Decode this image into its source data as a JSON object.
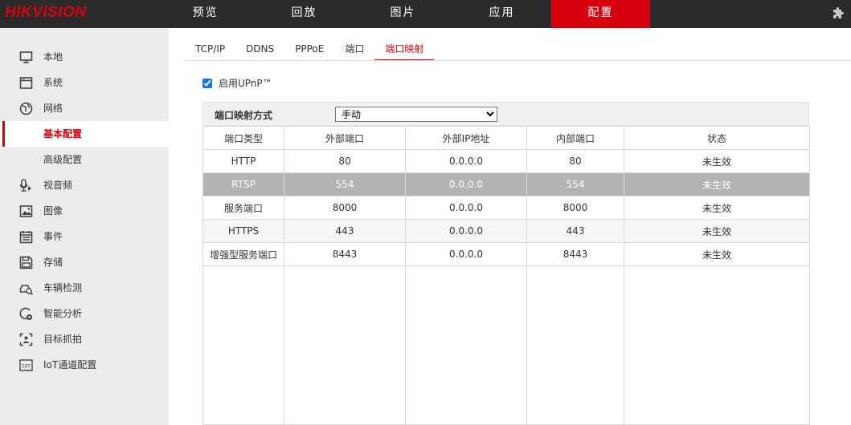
{
  "brand": {
    "logo_text": "HIKVISION",
    "accent": "#d7000f"
  },
  "nav": [
    {
      "label": "预览",
      "active": false
    },
    {
      "label": "回放",
      "active": false
    },
    {
      "label": "图片",
      "active": false
    },
    {
      "label": "应用",
      "active": false
    },
    {
      "label": "配置",
      "active": true
    }
  ],
  "sidebar": {
    "items": [
      {
        "label": "本地",
        "icon": "monitor-icon"
      },
      {
        "label": "系统",
        "icon": "system-icon"
      },
      {
        "label": "网络",
        "icon": "globe-icon"
      },
      {
        "label": "基本配置",
        "sub": true,
        "selected": true
      },
      {
        "label": "高级配置",
        "sub": true
      },
      {
        "label": "视音频",
        "icon": "microphone-icon"
      },
      {
        "label": "图像",
        "icon": "image-icon"
      },
      {
        "label": "事件",
        "icon": "calendar-icon"
      },
      {
        "label": "存储",
        "icon": "save-icon"
      },
      {
        "label": "车辆检测",
        "icon": "vehicle-detect-icon"
      },
      {
        "label": "智能分析",
        "icon": "smart-analysis-icon"
      },
      {
        "label": "目标抓拍",
        "icon": "capture-icon"
      },
      {
        "label": "IoT通道配置",
        "icon": "iot-icon"
      }
    ]
  },
  "tabs": [
    {
      "label": "TCP/IP",
      "active": false
    },
    {
      "label": "DDNS",
      "active": false
    },
    {
      "label": "PPPoE",
      "active": false
    },
    {
      "label": "端口",
      "active": false
    },
    {
      "label": "端口映射",
      "active": true
    }
  ],
  "upnp": {
    "label": "启用UPnP™",
    "checked": true
  },
  "mapping": {
    "label": "端口映射方式",
    "value": "手动"
  },
  "table": {
    "headers": [
      "端口类型",
      "外部端口",
      "外部IP地址",
      "内部端口",
      "状态"
    ],
    "rows": [
      [
        "HTTP",
        "80",
        "0.0.0.0",
        "80",
        "未生效"
      ],
      [
        "RTSP",
        "554",
        "0.0.0.0",
        "554",
        "未生效"
      ],
      [
        "服务端口",
        "8000",
        "0.0.0.0",
        "8000",
        "未生效"
      ],
      [
        "HTTPS",
        "443",
        "0.0.0.0",
        "443",
        "未生效"
      ],
      [
        "增强型服务端口",
        "8443",
        "0.0.0.0",
        "8443",
        "未生效"
      ]
    ]
  }
}
